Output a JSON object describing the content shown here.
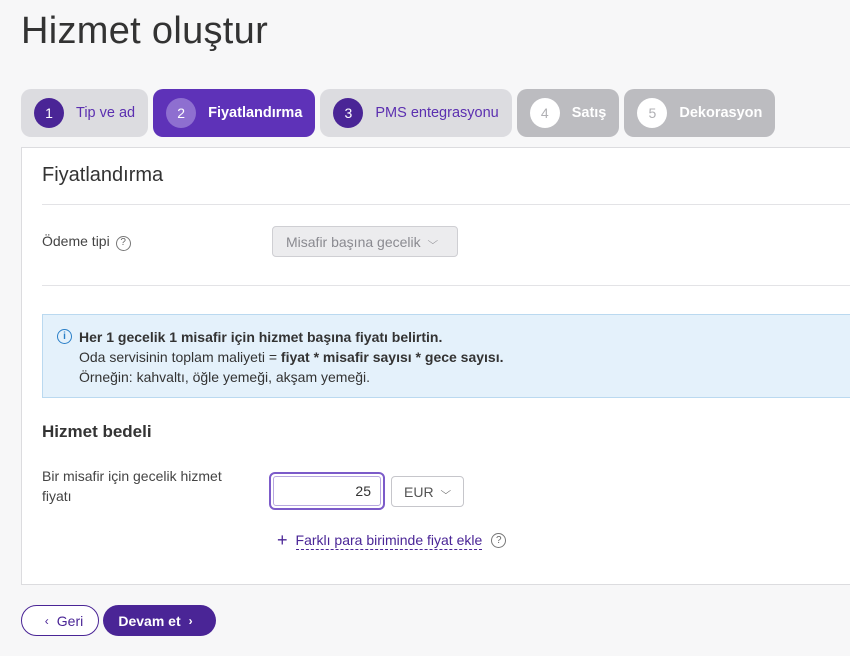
{
  "page": {
    "title": "Hizmet oluştur"
  },
  "steps": [
    {
      "num": "1",
      "label": "Tip ve ad",
      "state": "done"
    },
    {
      "num": "2",
      "label": "Fiyatlandırma",
      "state": "active"
    },
    {
      "num": "3",
      "label": "PMS entegrasyonu",
      "state": "done"
    },
    {
      "num": "4",
      "label": "Satış",
      "state": "disabled"
    },
    {
      "num": "5",
      "label": "Dekorasyon",
      "state": "disabled"
    }
  ],
  "card": {
    "title": "Fiyatlandırma",
    "payment_type": {
      "label": "Ödeme tipi",
      "value": "Misafir başına gecelik"
    },
    "info": {
      "line1": "Her 1 gecelik 1 misafir için hizmet başına fiyatı belirtin.",
      "line2_prefix": "Oda servisinin toplam maliyeti = ",
      "line2_bold": "fiyat * misafir sayısı * gece sayısı.",
      "line3": "Örneğin: kahvaltı, öğle yemeği, akşam yemeği."
    },
    "service_fee": {
      "heading": "Hizmet bedeli",
      "price_label": "Bir misafir için gecelik hizmet fiyatı",
      "price_value": "25",
      "currency": "EUR",
      "add_currency": "Farklı para biriminde fiyat ekle"
    }
  },
  "footer": {
    "back": "Geri",
    "next": "Devam et"
  },
  "colors": {
    "accent": "#4a2596",
    "active_step": "#5e32b8",
    "info_bg": "#e4f1fb"
  },
  "icons": [
    "help-icon",
    "info-icon",
    "chevron-down-icon",
    "plus-icon",
    "chevron-left-icon",
    "chevron-right-icon"
  ]
}
